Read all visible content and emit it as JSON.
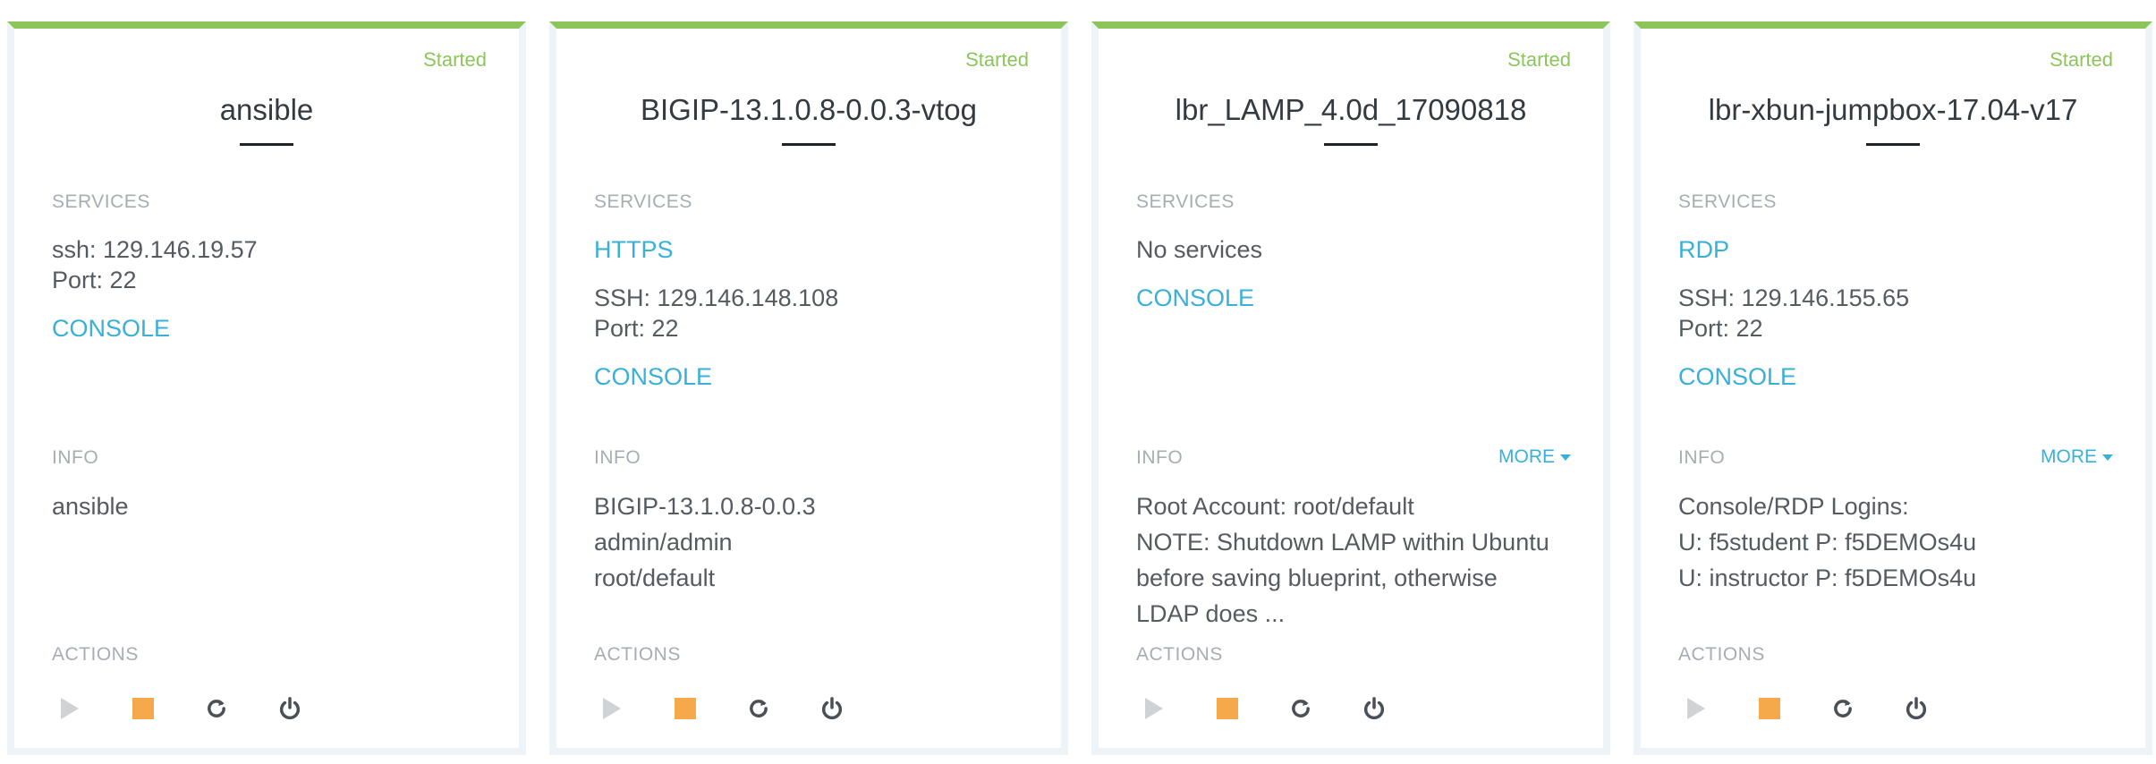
{
  "labels": {
    "services": "SERVICES",
    "info": "INFO",
    "actions": "ACTIONS",
    "more": "MORE",
    "console": "CONSOLE"
  },
  "colors": {
    "status_started": "#8cc65b",
    "link": "#3ab0d9",
    "stop_action": "#f5a94a",
    "play_action_disabled": "#cfd3d6",
    "card_border": "#eef3f7"
  },
  "icons": {
    "play": "play-icon",
    "stop": "stop-icon",
    "restart": "restart-icon",
    "power": "power-icon"
  },
  "cards": [
    {
      "status": "Started",
      "name": "ansible",
      "services": [
        {
          "text": "ssh: 129.146.19.57",
          "port": "Port: 22"
        }
      ],
      "info_lines": [
        "ansible"
      ]
    },
    {
      "status": "Started",
      "name": "BIGIP-13.1.0.8-0.0.3-vtog",
      "services": [
        {
          "link": "HTTPS"
        },
        {
          "text": "SSH: 129.146.148.108",
          "port": "Port: 22"
        }
      ],
      "info_lines": [
        "BIGIP-13.1.0.8-0.0.3",
        "admin/admin",
        "root/default"
      ]
    },
    {
      "status": "Started",
      "name": "lbr_LAMP_4.0d_17090818",
      "services": [
        {
          "text": "No services"
        }
      ],
      "info_lines": [
        "Root Account: root/default",
        "NOTE: Shutdown LAMP within Ubuntu",
        "before saving blueprint, otherwise",
        "LDAP does ..."
      ]
    },
    {
      "status": "Started",
      "name": "lbr-xbun-jumpbox-17.04-v17",
      "services": [
        {
          "link": "RDP"
        },
        {
          "text": "SSH: 129.146.155.65",
          "port": "Port: 22"
        }
      ],
      "info_lines": [
        "Console/RDP Logins:",
        "U: f5student P: f5DEMOs4u",
        "U: instructor P: f5DEMOs4u"
      ]
    }
  ]
}
